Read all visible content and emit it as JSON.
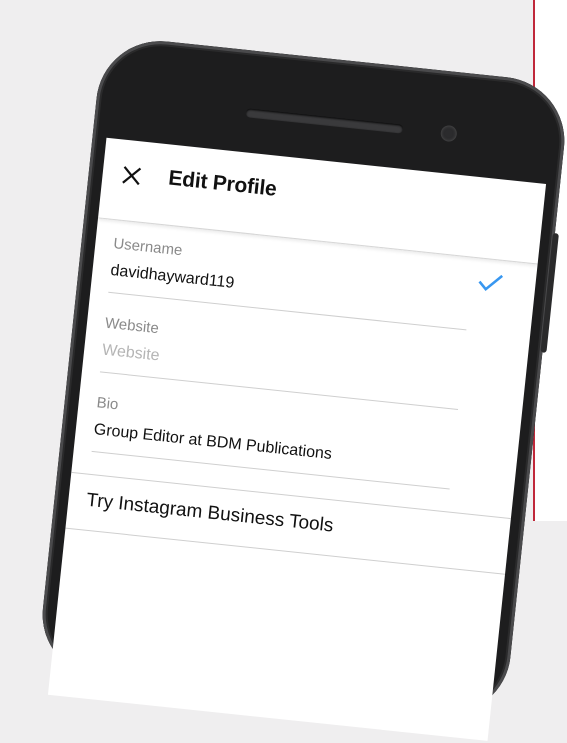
{
  "header": {
    "title": "Edit Profile",
    "close_icon": "close-icon",
    "confirm_icon": "check-icon",
    "accent_color": "#3897f0"
  },
  "fields": [
    {
      "label": "Username",
      "value": "davidhayward119"
    },
    {
      "label": "Website",
      "placeholder": "Website"
    },
    {
      "label": "Bio",
      "value": "Group Editor at BDM Publications"
    }
  ],
  "business_tools": {
    "label": "Try Instagram Business Tools"
  }
}
